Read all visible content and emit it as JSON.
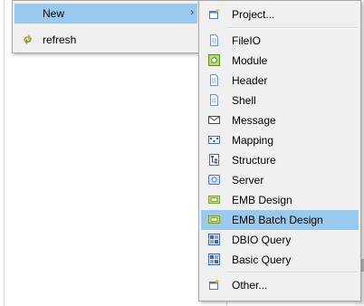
{
  "context_menu": {
    "items": [
      {
        "label": "New",
        "icon": "new-icon",
        "has_submenu": true,
        "highlighted": true
      },
      {
        "label": "refresh",
        "icon": "refresh-icon"
      }
    ]
  },
  "new_submenu": {
    "top_item": {
      "label": "Project...",
      "icon": "new-project-icon"
    },
    "items": [
      {
        "label": "FileIO",
        "icon": "file-icon"
      },
      {
        "label": "Module",
        "icon": "module-icon"
      },
      {
        "label": "Header",
        "icon": "file-icon"
      },
      {
        "label": "Shell",
        "icon": "file-icon"
      },
      {
        "label": "Message",
        "icon": "message-icon"
      },
      {
        "label": "Mapping",
        "icon": "mapping-icon"
      },
      {
        "label": "Structure",
        "icon": "structure-icon"
      },
      {
        "label": "Server",
        "icon": "server-icon"
      },
      {
        "label": "EMB Design",
        "icon": "emb-design-icon"
      },
      {
        "label": "EMB Batch Design",
        "icon": "emb-batch-design-icon",
        "highlighted": true
      },
      {
        "label": "DBIO Query",
        "icon": "dbio-query-icon"
      },
      {
        "label": "Basic Query",
        "icon": "basic-query-icon"
      }
    ],
    "bottom_item": {
      "label": "Other...",
      "icon": "new-other-icon"
    }
  },
  "colors": {
    "menu_bg": "#f0f0f0",
    "highlight": "#99c9ef",
    "border": "#a7a7a7"
  }
}
